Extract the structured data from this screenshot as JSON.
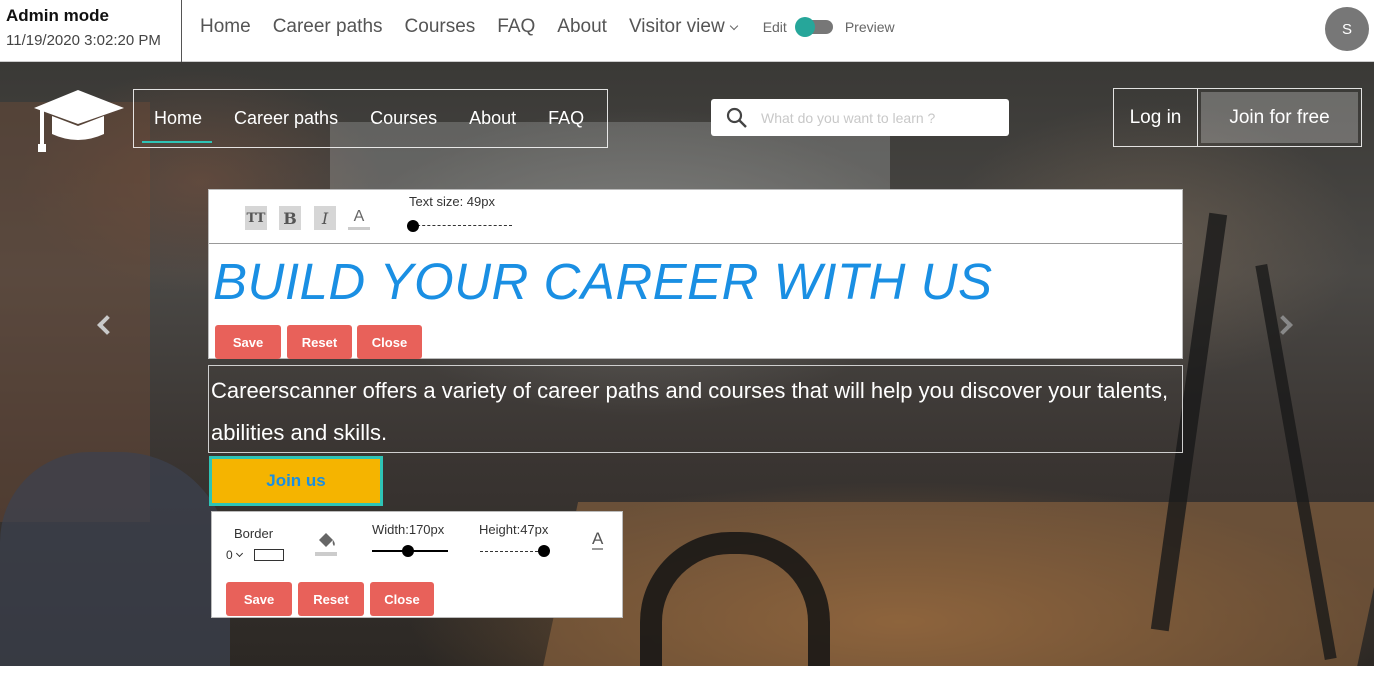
{
  "admin": {
    "mode_label": "Admin mode",
    "timestamp": "11/19/2020 3:02:20 PM",
    "nav": [
      "Home",
      "Career paths",
      "Courses",
      "FAQ",
      "About"
    ],
    "visitor_view_label": "Visitor view",
    "edit_label": "Edit",
    "preview_label": "Preview",
    "toggle_color": "#26a69a",
    "avatar_initial": "S"
  },
  "site": {
    "nav": [
      "Home",
      "Career paths",
      "Courses",
      "About",
      "FAQ"
    ],
    "active_nav": "Home",
    "search_placeholder": "What do you want to learn ?",
    "login_label": "Log in",
    "join_label": "Join for free",
    "accent": "#2ec4b6"
  },
  "title_editor": {
    "size_icon": "TT",
    "bold_icon": "B",
    "italic_icon": "I",
    "color_icon": "A",
    "text_size_label": "Text size: 49px",
    "save_label": "Save",
    "reset_label": "Reset",
    "close_label": "Close"
  },
  "hero": {
    "title": "BUILD YOUR CAREER WITH US",
    "title_color": "#1a8fe3",
    "subtitle": "Careerscanner offers a variety of career paths and courses that will help you discover your talents, abilities and skills.",
    "cta_label": "Join us",
    "cta_bg": "#f5b400"
  },
  "button_editor": {
    "border_label": "Border",
    "border_value": "0",
    "width_label": "Width:170px",
    "height_label": "Height:47px",
    "font_color_icon": "A",
    "save_label": "Save",
    "reset_label": "Reset",
    "close_label": "Close",
    "button_color": "#e8615a"
  }
}
